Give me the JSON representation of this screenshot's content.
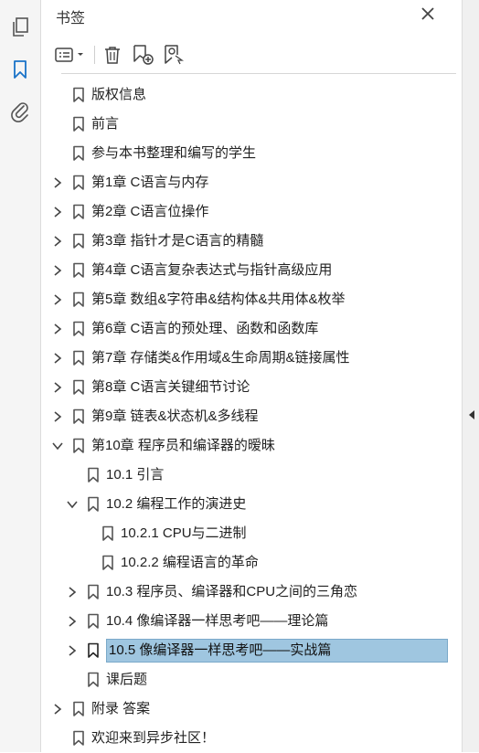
{
  "panel": {
    "title": "书签",
    "close_icon": "close-icon"
  },
  "rail": {
    "icons": [
      "pages-icon",
      "bookmark-icon",
      "attachment-icon"
    ]
  },
  "toolbar": {
    "icons": [
      "options-menu-icon",
      "delete-icon",
      "new-bookmark-icon",
      "find-bookmark-icon"
    ]
  },
  "bookmarks": [
    {
      "label": "版权信息",
      "level": 0,
      "expander": "none"
    },
    {
      "label": "前言",
      "level": 0,
      "expander": "none"
    },
    {
      "label": "参与本书整理和编写的学生",
      "level": 0,
      "expander": "none"
    },
    {
      "label": "第1章 C语言与内存",
      "level": 0,
      "expander": "collapsed"
    },
    {
      "label": "第2章 C语言位操作",
      "level": 0,
      "expander": "collapsed"
    },
    {
      "label": "第3章 指针才是C语言的精髓",
      "level": 0,
      "expander": "collapsed"
    },
    {
      "label": "第4章 C语言复杂表达式与指针高级应用",
      "level": 0,
      "expander": "collapsed"
    },
    {
      "label": "第5章 数组&字符串&结构体&共用体&枚举",
      "level": 0,
      "expander": "collapsed"
    },
    {
      "label": "第6章 C语言的预处理、函数和函数库",
      "level": 0,
      "expander": "collapsed"
    },
    {
      "label": "第7章 存储类&作用域&生命周期&链接属性",
      "level": 0,
      "expander": "collapsed"
    },
    {
      "label": "第8章 C语言关键细节讨论",
      "level": 0,
      "expander": "collapsed"
    },
    {
      "label": "第9章 链表&状态机&多线程",
      "level": 0,
      "expander": "collapsed"
    },
    {
      "label": "第10章 程序员和编译器的暧昧",
      "level": 0,
      "expander": "expanded"
    },
    {
      "label": "10.1 引言",
      "level": 1,
      "expander": "none"
    },
    {
      "label": "10.2 编程工作的演进史",
      "level": 1,
      "expander": "expanded"
    },
    {
      "label": "10.2.1 CPU与二进制",
      "level": 2,
      "expander": "none"
    },
    {
      "label": "10.2.2 编程语言的革命",
      "level": 2,
      "expander": "none"
    },
    {
      "label": "10.3 程序员、编译器和CPU之间的三角恋",
      "level": 1,
      "expander": "collapsed"
    },
    {
      "label": "10.4 像编译器一样思考吧——理论篇",
      "level": 1,
      "expander": "collapsed"
    },
    {
      "label": "10.5 像编译器一样思考吧——实战篇",
      "level": 1,
      "expander": "collapsed",
      "selected": true
    },
    {
      "label": "课后题",
      "level": 1,
      "expander": "none"
    },
    {
      "label": "附录 答案",
      "level": 0,
      "expander": "collapsed"
    },
    {
      "label": "欢迎来到异步社区！",
      "level": 0,
      "expander": "none"
    }
  ],
  "colors": {
    "selection": "#9fc6e0",
    "accent_icon": "#1a73c8"
  }
}
